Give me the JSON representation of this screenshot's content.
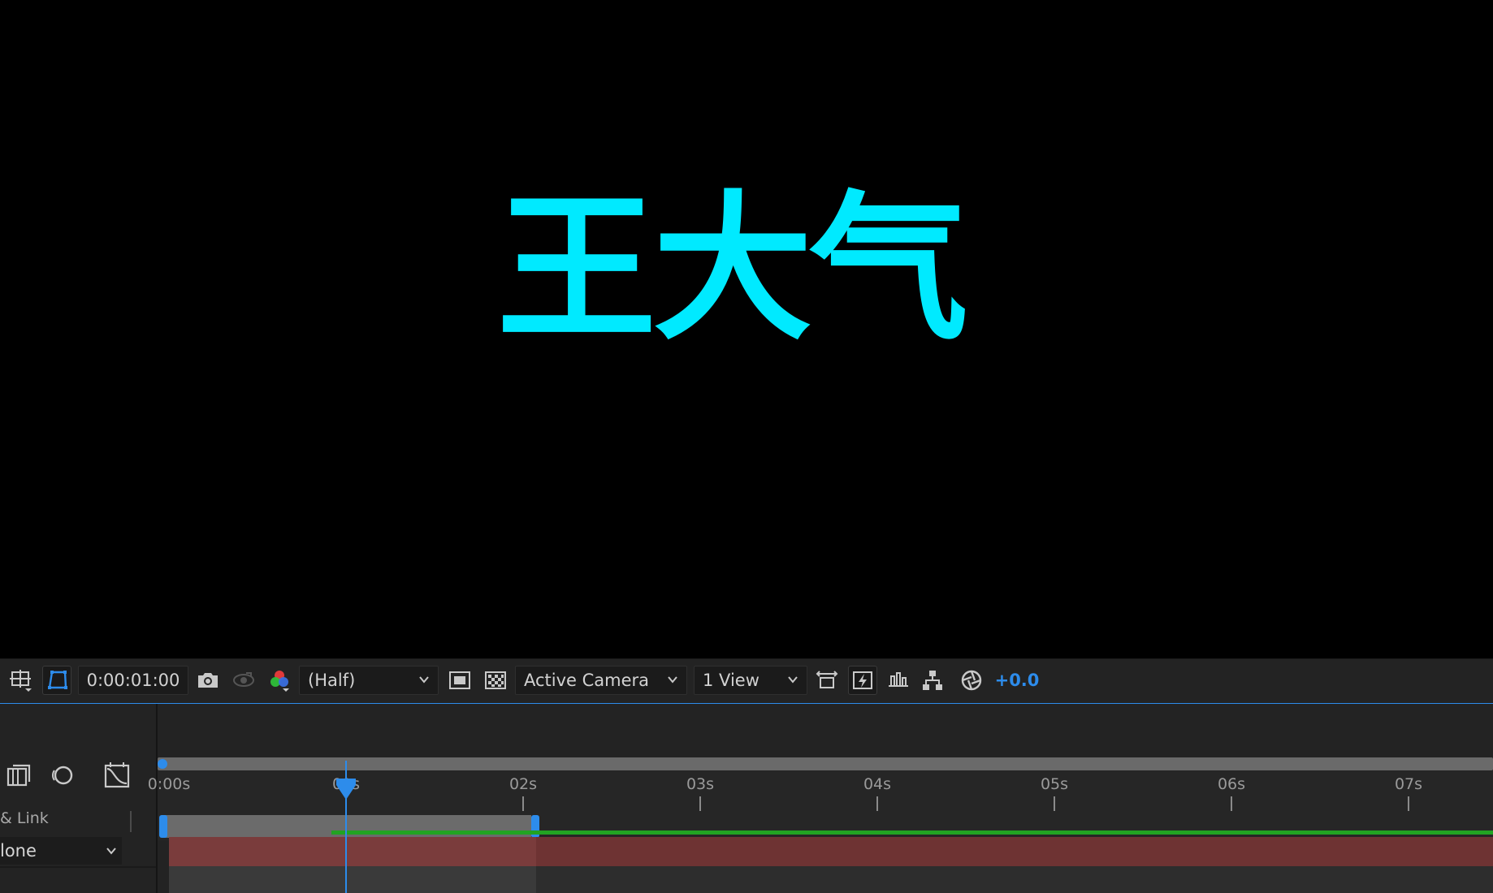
{
  "composition": {
    "text": "王大气",
    "text_color": "#00eaff"
  },
  "viewer_toolbar": {
    "timecode": "0:00:01:00",
    "resolution": "(Half)",
    "camera": "Active Camera",
    "views": "1 View",
    "exposure": "+0.0",
    "icons": [
      "region-of-interest-icon",
      "mask-path-visibility-icon",
      "snapshot-camera-icon",
      "show-snapshot-icon",
      "rgb-channels-icon",
      "fast-previews-icon",
      "transparency-grid-icon",
      "reset-exposure-icon"
    ],
    "accent_color": "#2d8ceb"
  },
  "timeline": {
    "ruler_labels": [
      "0:00s",
      "01s",
      "02s",
      "03s",
      "04s",
      "05s",
      "06s",
      "07s"
    ],
    "left_panel": {
      "column_label": "& Link",
      "select_value": "lone",
      "icons": [
        "composition-flowchart-icon",
        "motion-blur-icon",
        "graph-editor-icon"
      ]
    },
    "playhead_time": "01s",
    "colors": {
      "work_area": "#6b6b6b",
      "layer_bar": "#6e3333",
      "render_bar": "#22a322",
      "playhead": "#2d8ceb"
    }
  }
}
